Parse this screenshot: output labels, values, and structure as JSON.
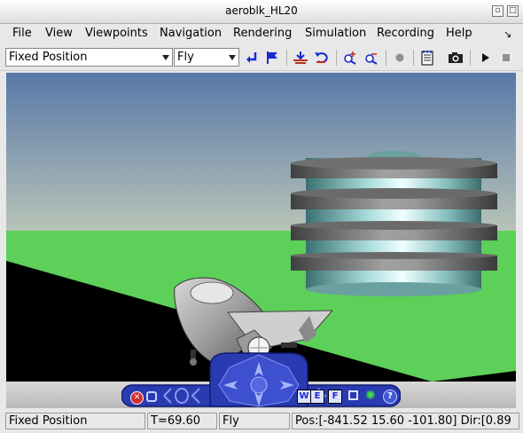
{
  "window": {
    "title": "aeroblk_HL20"
  },
  "menu": {
    "file": "File",
    "view": "View",
    "viewpoints": "Viewpoints",
    "navigation": "Navigation",
    "rendering": "Rendering",
    "simulation": "Simulation",
    "recording": "Recording",
    "help": "Help"
  },
  "toolbar": {
    "viewpoint_value": "Fixed Position",
    "nav_mode_value": "Fly"
  },
  "navpanel": {
    "w_label": "W",
    "e_label": "E",
    "f_label": "F",
    "help_label": "?"
  },
  "status": {
    "viewpoint": "Fixed Position",
    "time": "T=69.60",
    "mode": "Fly",
    "position": "Pos:[-841.52 15.60 -101.80] Dir:[0.89"
  },
  "colors": {
    "sky_top": "#5878a8",
    "ground": "#5cd058",
    "runway": "#000000",
    "navpanel": "#2a3ab0"
  },
  "icons": [
    "chevron-down-icon",
    "return-icon",
    "flag-icon",
    "straighten-icon",
    "undo-icon",
    "zoom-in-icon",
    "zoom-out-icon",
    "record-dot-icon",
    "notepad-icon",
    "camera-icon",
    "play-icon",
    "stop-icon",
    "close-icon",
    "orb-icon",
    "light-icon",
    "help-icon"
  ]
}
